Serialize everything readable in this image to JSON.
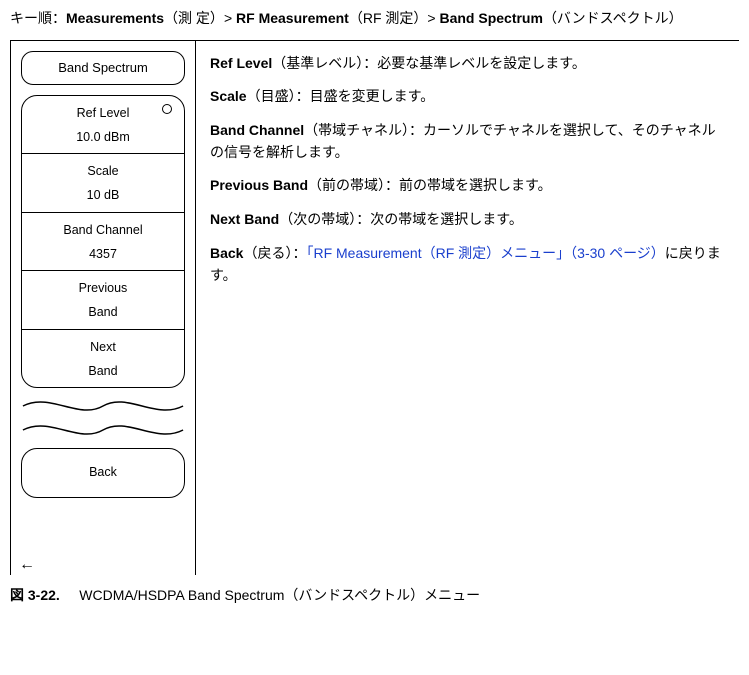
{
  "breadcrumb": {
    "prefix": "キー順：",
    "parts": [
      {
        "bold": "Measurements",
        "paren": "（測 定）"
      },
      {
        "bold": "RF Measurement",
        "paren": "（RF 測定）"
      },
      {
        "bold": "Band Spectrum",
        "paren": "（バンドスペクトル）"
      }
    ],
    "sep": "> "
  },
  "menu": {
    "header": "Band Spectrum",
    "keys": [
      {
        "line1": "Ref Level",
        "line2": "10.0 dBm",
        "radio": true
      },
      {
        "line1": "Scale",
        "line2": "10 dB"
      },
      {
        "line1": "Band Channel",
        "line2": "4357"
      },
      {
        "line1": "Previous",
        "line2": "Band"
      },
      {
        "line1": "Next",
        "line2": "Band"
      }
    ],
    "back": "Back"
  },
  "desc": {
    "ref": {
      "term": "Ref Level",
      "paren": "（基準レベル）",
      "body": "：必要な基準レベルを設定します。"
    },
    "scale": {
      "term": "Scale",
      "paren": "（目盛）",
      "body": "：目盛を変更します。"
    },
    "band": {
      "term": "Band Channel",
      "paren": "（帯域チャネル）",
      "body": "：カーソルでチャネルを選択して、そのチャネルの信号を解析します。"
    },
    "prev": {
      "term": "Previous Band",
      "paren": "（前の帯域）",
      "body": "：前の帯域を選択します。"
    },
    "next": {
      "term": "Next Band",
      "paren": "（次の帯域）",
      "body": "：次の帯域を選択します。"
    },
    "back": {
      "term": "Back",
      "paren": "（戻る）",
      "lead": "：",
      "link": "「RF Measurement（RF 測定）メニュー」（3-30 ページ）",
      "tail": "に戻ります。"
    }
  },
  "figcap": {
    "label": "図  3-22.",
    "text": "WCDMA/HSDPA Band Spectrum（バンドスペクトル）メニュー"
  }
}
